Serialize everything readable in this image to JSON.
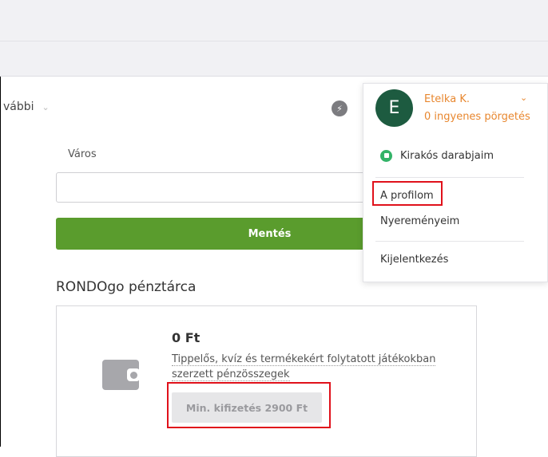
{
  "nav": {
    "more_label": "vábbi",
    "more_chevron": "⌄"
  },
  "icons": {
    "bolt": "⚡",
    "wallet": "wallet-icon",
    "puzzle": "puzzle-icon"
  },
  "profile_form": {
    "city_label": "Város",
    "city_value": "",
    "save_label": "Mentés"
  },
  "wallet": {
    "title": "RONDOgo pénztárca",
    "amount": "0 Ft",
    "description": "Tippelős, kvíz és termékekért folytatott játékokban szerzett pénzösszegek",
    "min_payout_label": "Min. kifizetés 2900 Ft"
  },
  "user_menu": {
    "avatar_initial": "E",
    "user_name": "Etelka K.",
    "free_spins": "0 ingyenes pörgetés",
    "chevron": "⌄",
    "items": [
      {
        "label": "Kirakós darabjaim"
      },
      {
        "label": "A profilom"
      },
      {
        "label": "Nyereményeim"
      },
      {
        "label": "Kijelentkezés"
      }
    ]
  },
  "colors": {
    "accent_green": "#5a9c2d",
    "avatar_green": "#1d5b40",
    "user_orange": "#e8872f",
    "highlight_red": "#e0111b"
  }
}
